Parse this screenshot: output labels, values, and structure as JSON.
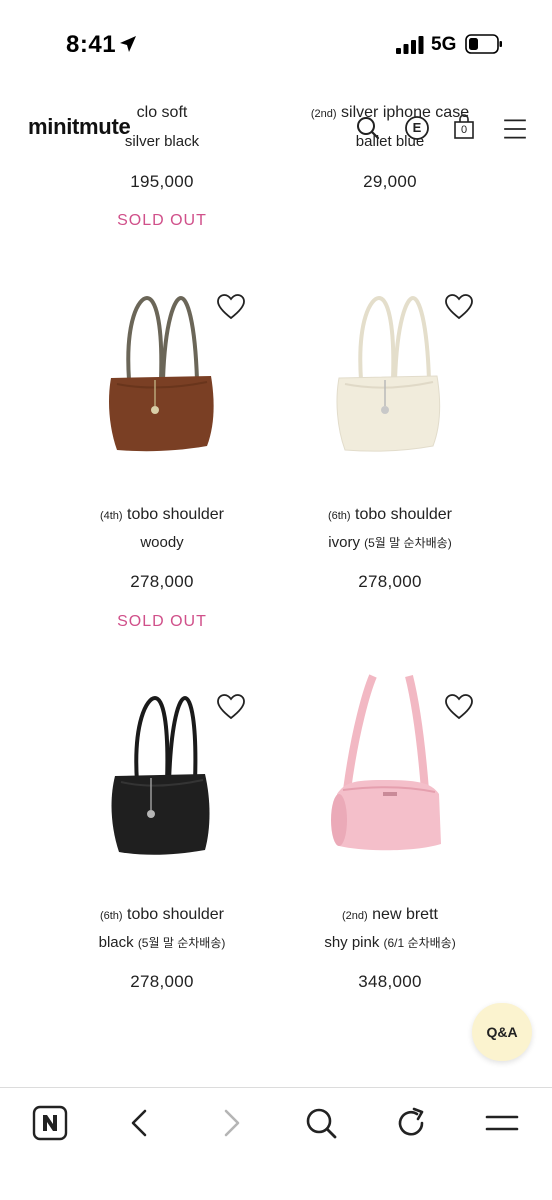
{
  "status_bar": {
    "time": "8:41",
    "network": "5G"
  },
  "header": {
    "logo": "minitmute",
    "cart_count": "0",
    "badge_letter": "E"
  },
  "products": [
    {
      "order": "",
      "name": "clo soft",
      "color": "silver black",
      "note": "",
      "price": "195,000",
      "sold_out": "SOLD OUT"
    },
    {
      "order": "(2nd)",
      "name": "silver iphone case",
      "color": "ballet blue",
      "note": "",
      "price": "29,000",
      "sold_out": ""
    },
    {
      "order": "(4th)",
      "name": "tobo shoulder",
      "color": "woody",
      "note": "",
      "price": "278,000",
      "sold_out": "SOLD OUT"
    },
    {
      "order": "(6th)",
      "name": "tobo shoulder",
      "color": "ivory",
      "note": "(5월 말 순차배송)",
      "price": "278,000",
      "sold_out": ""
    },
    {
      "order": "(6th)",
      "name": "tobo shoulder",
      "color": "black",
      "note": "(5월 말 순차배송)",
      "price": "278,000",
      "sold_out": ""
    },
    {
      "order": "(2nd)",
      "name": "new brett",
      "color": "shy pink",
      "note": "(6/1 순차배송)",
      "price": "348,000",
      "sold_out": ""
    }
  ],
  "qna_button": "Q&A",
  "toolbar": {
    "items": [
      "naver-home-icon",
      "back-icon",
      "forward-icon",
      "search-icon",
      "reload-icon",
      "menu-icon"
    ]
  },
  "colors": {
    "sold_out": "#d0508a",
    "qna_bg": "#fbf3cf",
    "bag_woody": "#7a3f24",
    "bag_ivory": "#f1ecdc",
    "bag_black": "#1f1f1f",
    "bag_pink": "#f2b8c3"
  }
}
